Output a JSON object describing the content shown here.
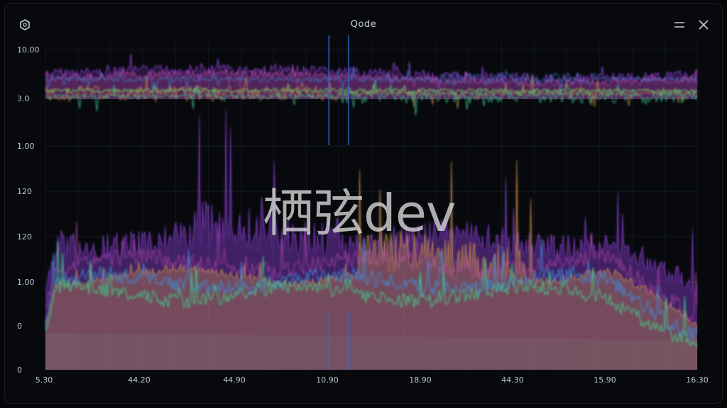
{
  "window": {
    "title": "Qode"
  },
  "icons": {
    "app": "hexagon-icon",
    "menu": "hamburger-menu-icon",
    "close": "close-icon"
  },
  "watermark": "栖弦dev",
  "chart_data": {
    "type": "area",
    "panels": [
      {
        "name": "upper",
        "y_tick_labels": [
          "10.00",
          "3.0",
          "1.00"
        ],
        "background": "#07090d"
      },
      {
        "name": "lower",
        "y_tick_labels": [
          "120",
          "120",
          "1.00",
          "0",
          "0"
        ]
      }
    ],
    "x_tick_labels": [
      "5.30",
      "44.20",
      "44.90",
      "10.90",
      "18.90",
      "44.30",
      "15.90",
      "16.30"
    ],
    "series_colors": [
      "#8a3fd1",
      "#d24fb8",
      "#d79a4e",
      "#3b8fe0",
      "#3fd28a",
      "#79e05a"
    ],
    "grid": true,
    "legend": "none",
    "markers": [
      0.435,
      0.465
    ]
  }
}
